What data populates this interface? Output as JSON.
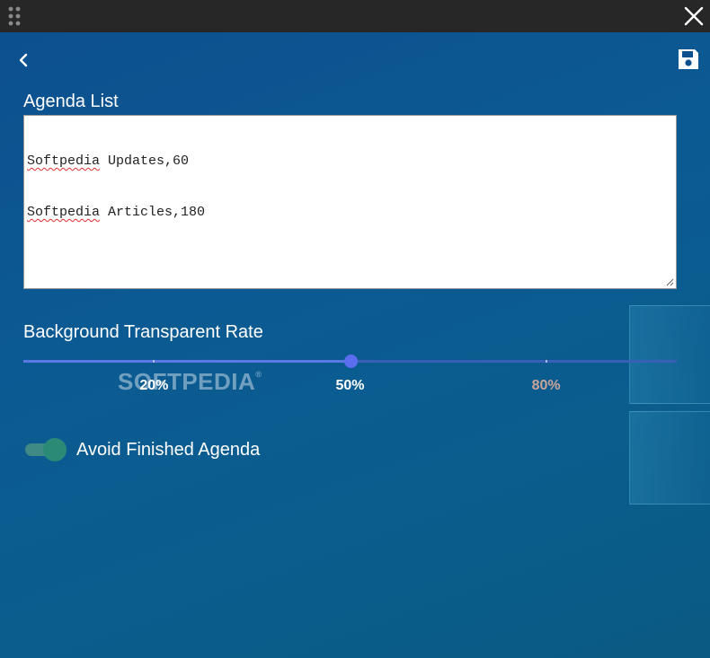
{
  "titlebar": {
    "drag_handle_icon": "drag-dots-icon",
    "close_icon": "close-icon",
    "background_color": "#272727"
  },
  "header": {
    "back_icon": "chevron-left-icon",
    "save_icon": "floppy-disk-icon"
  },
  "agenda": {
    "title": "Agenda List",
    "lines": [
      {
        "name": "Softpedia",
        "rest": " Updates,60"
      },
      {
        "name": "Softpedia",
        "rest": " Articles,180"
      }
    ]
  },
  "background": {
    "title": "Background Transparent Rate",
    "value_percent": 50,
    "marks": [
      {
        "label": "20%",
        "value": 20,
        "color": "#ffffff"
      },
      {
        "label": "50%",
        "value": 50,
        "color": "#ffffff"
      },
      {
        "label": "80%",
        "value": 80,
        "color": "#c9a49a"
      }
    ],
    "track_color": "#3a5fb8",
    "fill_color": "#5a78e6",
    "thumb_color": "#5b6ef0"
  },
  "avoid_finished": {
    "label": "Avoid Finished Agenda",
    "enabled": true,
    "color": "#2a8a75"
  },
  "watermark": {
    "text": "SOFTPEDIA",
    "mark": "®"
  }
}
